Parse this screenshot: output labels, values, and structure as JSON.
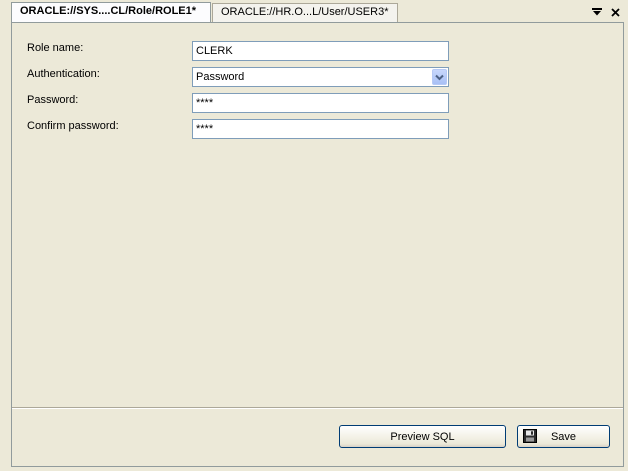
{
  "tabs": [
    {
      "label": "ORACLE://SYS....CL/Role/ROLE1*",
      "active": true
    },
    {
      "label": "ORACLE://HR.O...L/User/USER3*",
      "active": false
    }
  ],
  "form": {
    "role_name": {
      "label": "Role name:",
      "value": "CLERK"
    },
    "authentication": {
      "label": "Authentication:",
      "value": "Password"
    },
    "password": {
      "label": "Password:",
      "value": "****"
    },
    "confirm_password": {
      "label": "Confirm password:",
      "value": "****"
    }
  },
  "buttons": {
    "preview_sql": "Preview SQL",
    "save": "Save"
  },
  "icons": {
    "tab_menu": "chevron-down-icon",
    "tab_close": "close-icon",
    "select_arrow": "chevron-down-icon",
    "save": "floppy-disk-icon"
  }
}
